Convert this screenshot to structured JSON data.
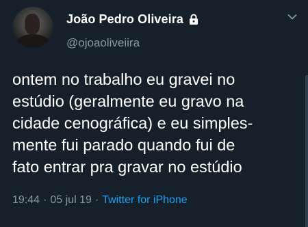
{
  "tweet": {
    "display_name": "João Pedro Oliveira",
    "handle": "@ojoaoliveiira",
    "text": "ontem no trabalho eu gravei no\nestúdio (geralmente eu gravo na\ncidade cenográfica) e eu simples-\nmente fui parado quando fui de\nfato entrar pra gravar no estúdio",
    "time": "19:44",
    "separator": "·",
    "date": "05 jul 19",
    "source": "Twitter for iPhone"
  },
  "icons": {
    "lock": "lock-icon",
    "menu": "chevron-down-icon"
  },
  "colors": {
    "background": "#15202b",
    "text": "#ffffff",
    "secondary": "#8899a6",
    "link": "#1da1f2"
  }
}
